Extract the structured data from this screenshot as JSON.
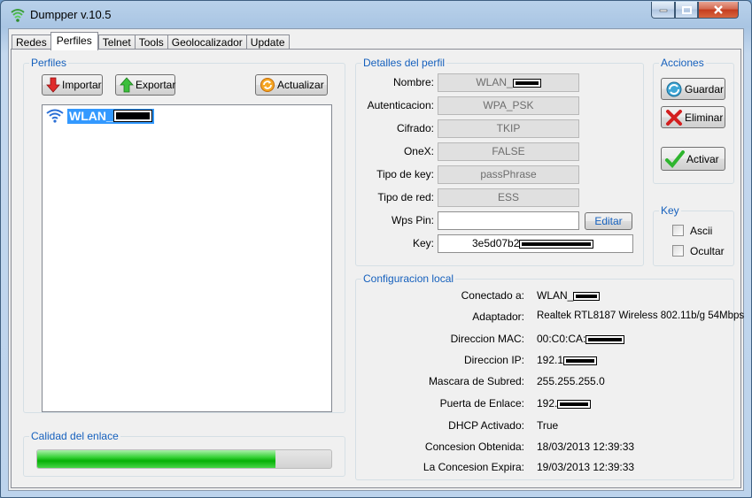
{
  "window": {
    "title": "Dumpper v.10.5"
  },
  "tabs": [
    "Redes",
    "Perfiles",
    "Telnet",
    "Tools",
    "Geolocalizador",
    "Update"
  ],
  "active_tab": "Perfiles",
  "perfiles": {
    "group_label": "Perfiles",
    "import_label": "Importar",
    "export_label": "Exportar",
    "refresh_label": "Actualizar",
    "items": [
      {
        "name": "WLAN_"
      }
    ]
  },
  "detalles": {
    "group_label": "Detalles del perfil",
    "fields": {
      "nombre": {
        "label": "Nombre:",
        "value": "WLAN_"
      },
      "autenticacion": {
        "label": "Autenticacion:",
        "value": "WPA_PSK"
      },
      "cifrado": {
        "label": "Cifrado:",
        "value": "TKIP"
      },
      "onex": {
        "label": "OneX:",
        "value": "FALSE"
      },
      "tipo_key": {
        "label": "Tipo de key:",
        "value": "passPhrase"
      },
      "tipo_red": {
        "label": "Tipo de red:",
        "value": "ESS"
      },
      "wps_pin": {
        "label": "Wps Pin:",
        "value": ""
      },
      "key": {
        "label": "Key:",
        "value": "3e5d07b2"
      }
    },
    "edit_label": "Editar"
  },
  "acciones": {
    "group_label": "Acciones",
    "save_label": "Guardar",
    "delete_label": "Eliminar",
    "activate_label": "Activar"
  },
  "key_group": {
    "group_label": "Key",
    "ascii_label": "Ascii",
    "ocultar_label": "Ocultar"
  },
  "config": {
    "group_label": "Configuracion local",
    "rows": {
      "conectado": {
        "label": "Conectado a:",
        "value": "WLAN_"
      },
      "adaptador": {
        "label": "Adaptador:",
        "value": "Realtek RTL8187 Wireless 802.11b/g 54Mbps"
      },
      "mac": {
        "label": "Direccion MAC:",
        "value": "00:C0:CA:"
      },
      "ip": {
        "label": "Direccion IP:",
        "value": "192.1"
      },
      "mascara": {
        "label": "Mascara de Subred:",
        "value": "255.255.255.0"
      },
      "puerta": {
        "label": "Puerta de Enlace:",
        "value": "192."
      },
      "dhcp": {
        "label": "DHCP Activado:",
        "value": "True"
      },
      "obtenida": {
        "label": "Concesion Obtenida:",
        "value": "18/03/2013 12:39:33"
      },
      "expira": {
        "label": "La Concesion Expira:",
        "value": "19/03/2013 12:39:33"
      }
    }
  },
  "calidad": {
    "group_label": "Calidad del enlace",
    "level_percent": 81
  },
  "icons": {
    "app": "wifi-signal-icon",
    "import": "red-down-arrow-icon",
    "export": "green-up-arrow-icon",
    "refresh": "refresh-icon",
    "save": "save-icon",
    "delete": "red-x-icon",
    "activate": "green-check-icon"
  }
}
